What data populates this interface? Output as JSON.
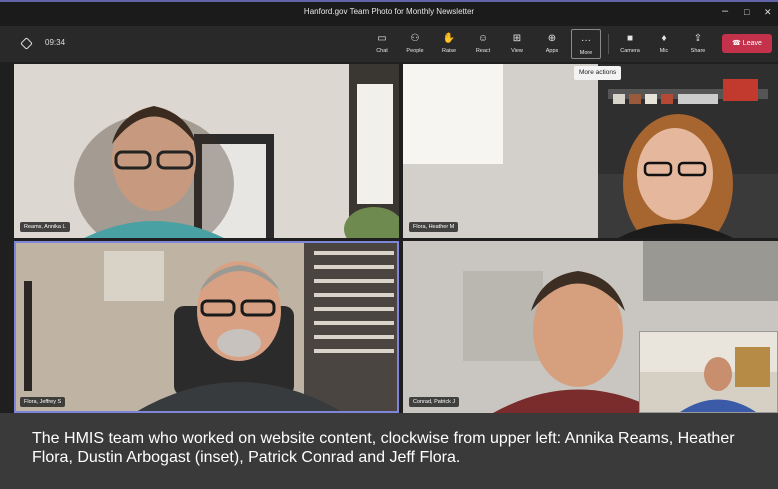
{
  "window": {
    "title": "Hanford.gov Team Photo for Monthly Newsletter",
    "minimize_glyph": "–",
    "maximize_glyph": "□",
    "close_glyph": "✕"
  },
  "meeting": {
    "elapsed": "09:34"
  },
  "toolbar": {
    "items": [
      {
        "label": "Chat",
        "icon": "chat-icon",
        "glyph": "▭"
      },
      {
        "label": "People",
        "icon": "people-icon",
        "glyph": "⚇"
      },
      {
        "label": "Raise",
        "icon": "hand-icon",
        "glyph": "✋"
      },
      {
        "label": "React",
        "icon": "smiley-icon",
        "glyph": "☺"
      },
      {
        "label": "View",
        "icon": "layout-icon",
        "glyph": "⊞"
      },
      {
        "label": "Apps",
        "icon": "apps-icon",
        "glyph": "⊕"
      },
      {
        "label": "More",
        "icon": "more-icon",
        "glyph": "···"
      },
      {
        "label": "Camera",
        "icon": "camera-icon",
        "glyph": "■"
      },
      {
        "label": "Mic",
        "icon": "mic-icon",
        "glyph": "♦"
      },
      {
        "label": "Share",
        "icon": "share-icon",
        "glyph": "⇪"
      }
    ],
    "leave_label": "Leave",
    "leave_glyph": "☎",
    "tooltip": "More actions",
    "leave_color": "#c4314b",
    "accent_color": "#6264a7"
  },
  "participants": [
    {
      "name": "Reams, Annika L"
    },
    {
      "name": "Flora, Heather M"
    },
    {
      "name": "Flora, Jeffrey S"
    },
    {
      "name": "Conrad, Patrick J"
    }
  ],
  "caption": "The HMIS team who worked on website content, clockwise from upper left: Annika Reams, Heather Flora, Dustin Arbogast (inset), Patrick Conrad and Jeff Flora."
}
